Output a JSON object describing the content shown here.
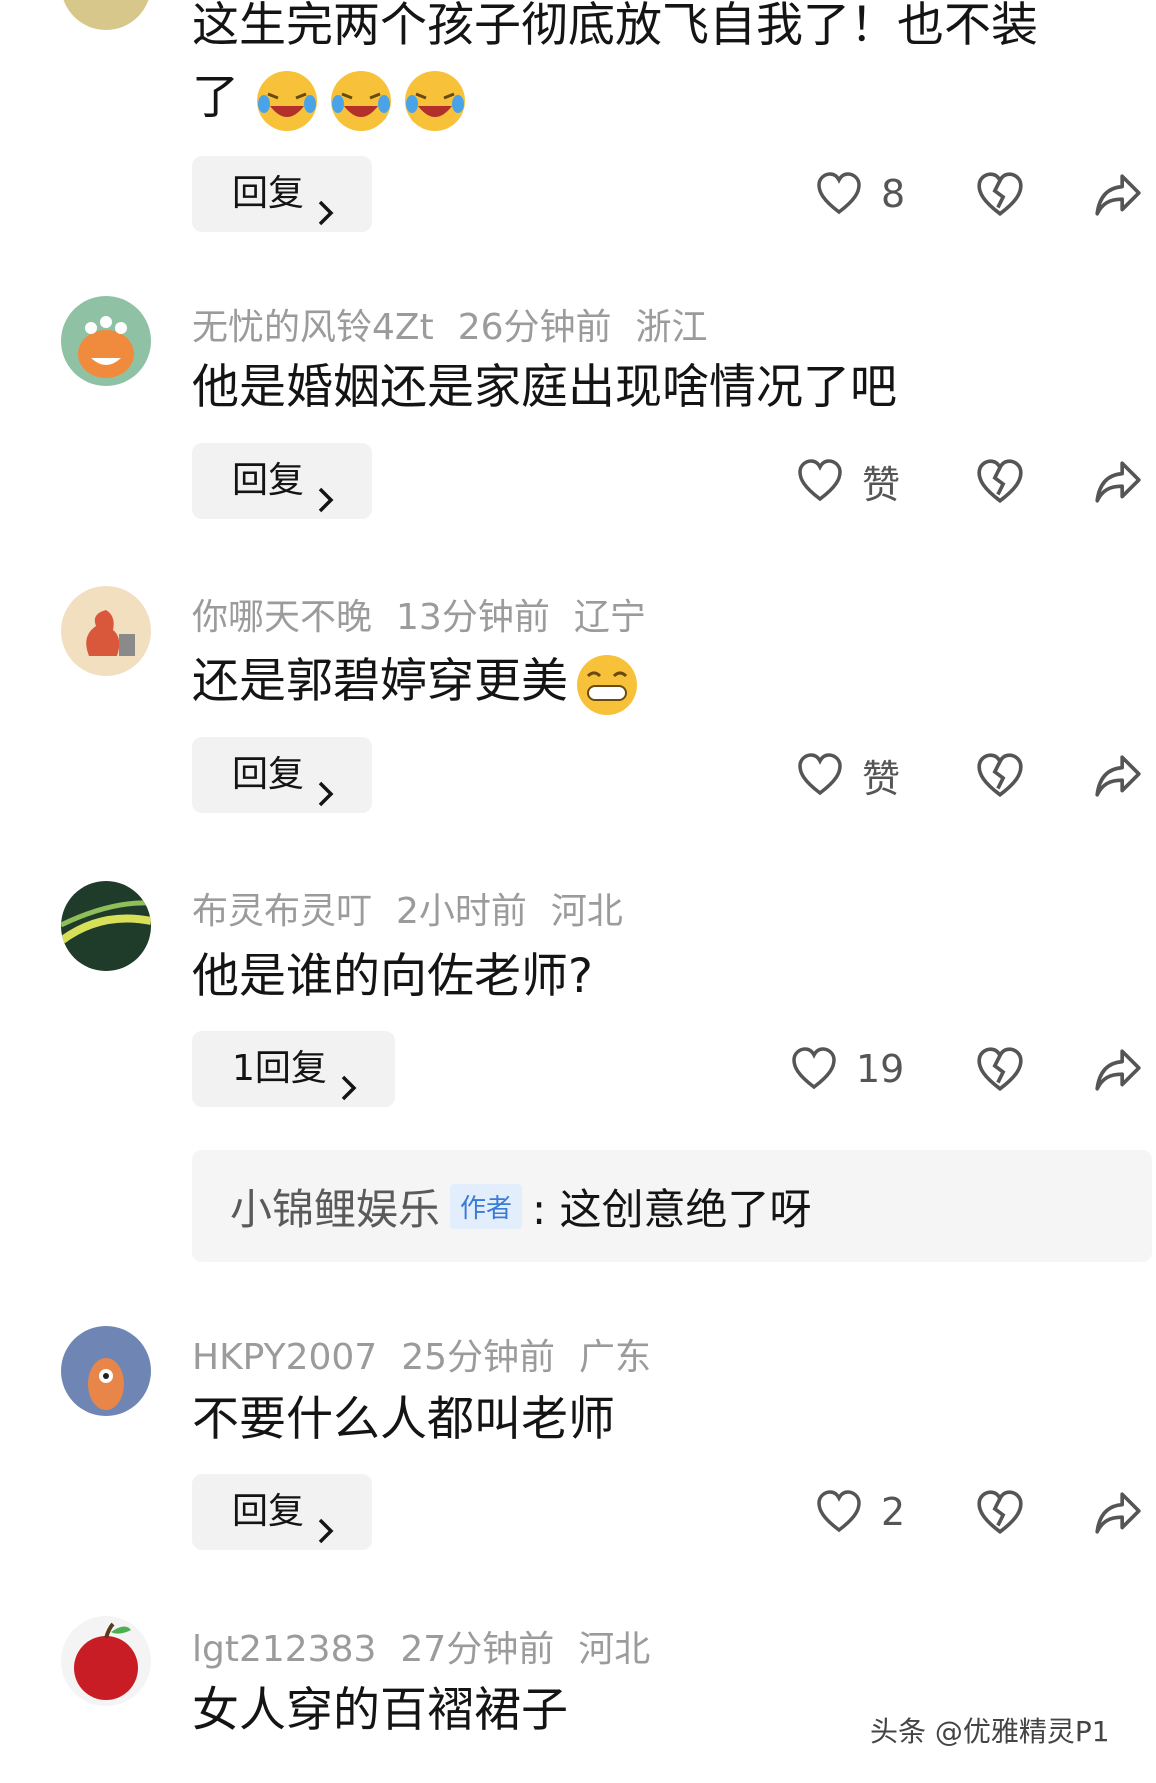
{
  "comments": [
    {
      "text_line1": "这生完两个孩子彻底放飞自我了！也不装",
      "text_line2": "了",
      "reply_label": "回复",
      "likes": "8"
    },
    {
      "username": "无忧的风铃4Zt",
      "time": "26分钟前",
      "location": "浙江",
      "text": "他是婚姻还是家庭出现啥情况了吧",
      "reply_label": "回复",
      "likes": "赞"
    },
    {
      "username": "你哪天不晚",
      "time": "13分钟前",
      "location": "辽宁",
      "text": "还是郭碧婷穿更美",
      "reply_label": "回复",
      "likes": "赞"
    },
    {
      "username": "布灵布灵叮",
      "time": "2小时前",
      "location": "河北",
      "text": "他是谁的向佐老师?",
      "reply_label": "1回复",
      "likes": "19",
      "author_reply": {
        "name": "小锦鲤娱乐",
        "badge": "作者",
        "text": ": 这创意绝了呀"
      }
    },
    {
      "username": "HKPY2007",
      "time": "25分钟前",
      "location": "广东",
      "text": "不要什么人都叫老师",
      "reply_label": "回复",
      "likes": "2"
    },
    {
      "username": "lgt212383",
      "time": "27分钟前",
      "location": "河北",
      "text": "女人穿的百褶裙子"
    }
  ],
  "watermark": "头条 @优雅精灵P1"
}
